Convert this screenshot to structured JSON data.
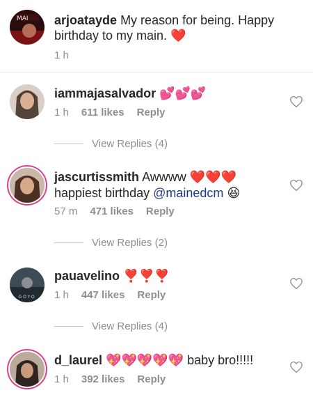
{
  "caption": {
    "username": "arjoatayde",
    "text": "My reason for being. Happy birthday to my main.",
    "emoji": "❤️",
    "time": "1 h"
  },
  "comments": [
    {
      "username": "iammajasalvador",
      "text": "",
      "emoji": "💕💕💕",
      "time": "1 h",
      "likes": "611 likes",
      "reply_label": "Reply",
      "view_replies": "View Replies (4)"
    },
    {
      "username": "jascurtissmith",
      "text_line1": "Awwww",
      "emoji_line1": "❤️❤️❤️",
      "text_line2": "happiest birthday",
      "mention": "@mainedcm",
      "emoji_line2": "😆",
      "time": "57 m",
      "likes": "471 likes",
      "reply_label": "Reply",
      "view_replies": "View Replies (2)"
    },
    {
      "username": "pauavelino",
      "text": "",
      "emoji": "❣️❣️❣️",
      "time": "1 h",
      "likes": "447 likes",
      "reply_label": "Reply",
      "view_replies": "View Replies (4)"
    },
    {
      "username": "d_laurel",
      "emoji": "💖💖💖💖💖",
      "text": "baby bro!!!!!",
      "time": "1 h",
      "likes": "392 likes",
      "reply_label": "Reply"
    }
  ],
  "avatar_art": {
    "label": "GOYO"
  },
  "colors": {
    "text": "#262626",
    "meta": "#8e8e8e",
    "mention": "#233b83",
    "divider": "#e3e3e3",
    "story_ring": "#d93f8a"
  },
  "icons": {
    "like": "heart-outline-icon"
  }
}
